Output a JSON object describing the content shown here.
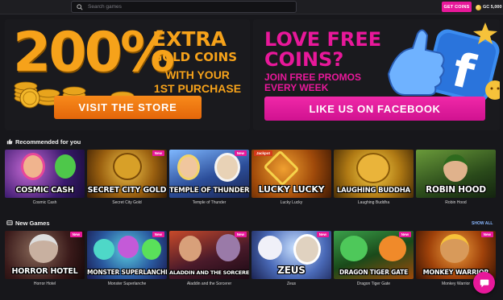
{
  "topbar": {
    "search_placeholder": "Search games",
    "get_coins_label": "GET COINS",
    "balance": "GC 5,000"
  },
  "promo_left": {
    "percent": "200%",
    "line1": "EXTRA",
    "line2": "GOLD COINS",
    "line3": "WITH YOUR",
    "line4": "1ST PURCHASE",
    "button": "VISIT THE STORE"
  },
  "promo_right": {
    "line1": "LOVE FREE",
    "line2": "COINS?",
    "line3": "JOIN FREE PROMOS",
    "line4": "EVERY WEEK",
    "button": "LIKE US ON FACEBOOK"
  },
  "recommended": {
    "title": "Recommended for you",
    "games": [
      {
        "art_title": "COSMIC CASH",
        "caption": "Cosmic Cash",
        "badge": ""
      },
      {
        "art_title": "SECRET CITY GOLD",
        "caption": "Secret City Gold",
        "badge": "New"
      },
      {
        "art_title": "TEMPLE OF THUNDER",
        "caption": "Temple of Thunder",
        "badge": "New"
      },
      {
        "art_title": "LUCKY LUCKY",
        "caption": "Lucky Lucky",
        "badge": "Jackpot"
      },
      {
        "art_title": "LAUGHING BUDDHA",
        "caption": "Laughing Buddha",
        "badge": ""
      },
      {
        "art_title": "ROBIN HOOD",
        "caption": "Robin Hood",
        "badge": ""
      }
    ]
  },
  "new_games": {
    "title": "New Games",
    "show_all": "SHOW ALL",
    "games": [
      {
        "art_title": "HORROR HOTEL",
        "caption": "Horror Hotel",
        "badge": "New"
      },
      {
        "art_title": "MONSTER SUPERLANCHE",
        "caption": "Monster Superlanche",
        "badge": "New"
      },
      {
        "art_title": "ALADDIN AND THE SORCERER",
        "caption": "Aladdin and the Sorcerer",
        "badge": "New"
      },
      {
        "art_title": "ZEUS",
        "caption": "Zeus",
        "badge": "New"
      },
      {
        "art_title": "DRAGON TIGER GATE",
        "caption": "Dragon Tiger Gate",
        "badge": "New"
      },
      {
        "art_title": "MONKEY WARRIOR",
        "caption": "Monkey Warrior",
        "badge": "New"
      }
    ]
  },
  "colors": {
    "accent_pink": "#e8189a",
    "accent_orange": "#f6a21a",
    "background": "#17171b"
  }
}
